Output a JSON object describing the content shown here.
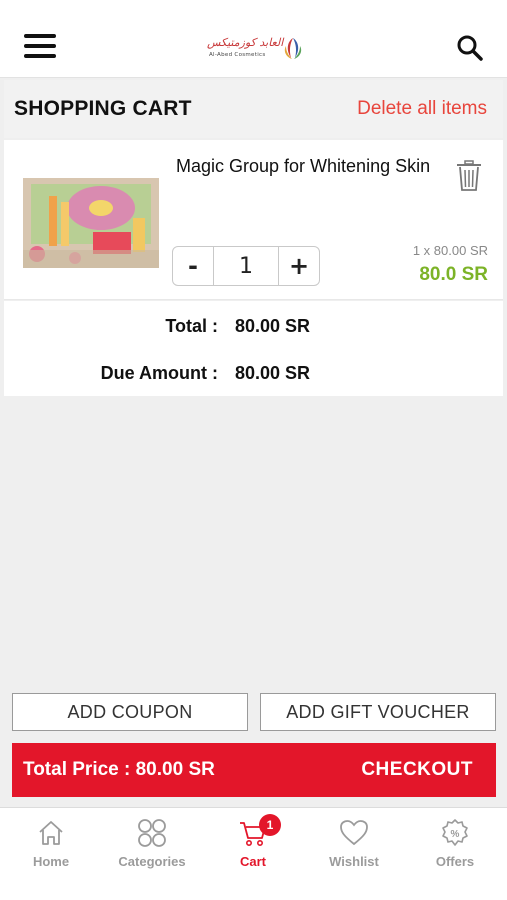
{
  "header": {
    "logo_arabic": "العابد كوزمتيكس",
    "logo_english": "Al-Abed Cosmetics"
  },
  "cart_header": {
    "title": "SHOPPING CART",
    "delete_all_label": "Delete all items"
  },
  "cart_items": [
    {
      "name": "Magic Group for Whitening Skin",
      "quantity": "1",
      "decrement_label": "-",
      "increment_label": "+",
      "unit_price": "1 x 80.00 SR",
      "line_total": "80.0 SR"
    }
  ],
  "totals": {
    "total_label": "Total  :",
    "total_value": "80.00 SR",
    "due_label": "Due Amount  :",
    "due_value": "80.00 SR"
  },
  "actions": {
    "add_coupon_label": "ADD COUPON",
    "add_gift_voucher_label": "ADD GIFT VOUCHER"
  },
  "checkout": {
    "total_price_text": "Total Price : 80.00 SR",
    "checkout_label": "CHECKOUT"
  },
  "tabbar": {
    "items": [
      {
        "label": "Home",
        "icon": "home-icon"
      },
      {
        "label": "Categories",
        "icon": "categories-icon"
      },
      {
        "label": "Cart",
        "icon": "cart-icon",
        "badge": "1",
        "active": true
      },
      {
        "label": "Wishlist",
        "icon": "heart-icon"
      },
      {
        "label": "Offers",
        "icon": "offers-icon"
      }
    ]
  },
  "colors": {
    "accent_red": "#e3162a",
    "delete_red": "#e8453c",
    "price_green": "#7cb327",
    "inactive_gray": "#9b9b9b"
  }
}
